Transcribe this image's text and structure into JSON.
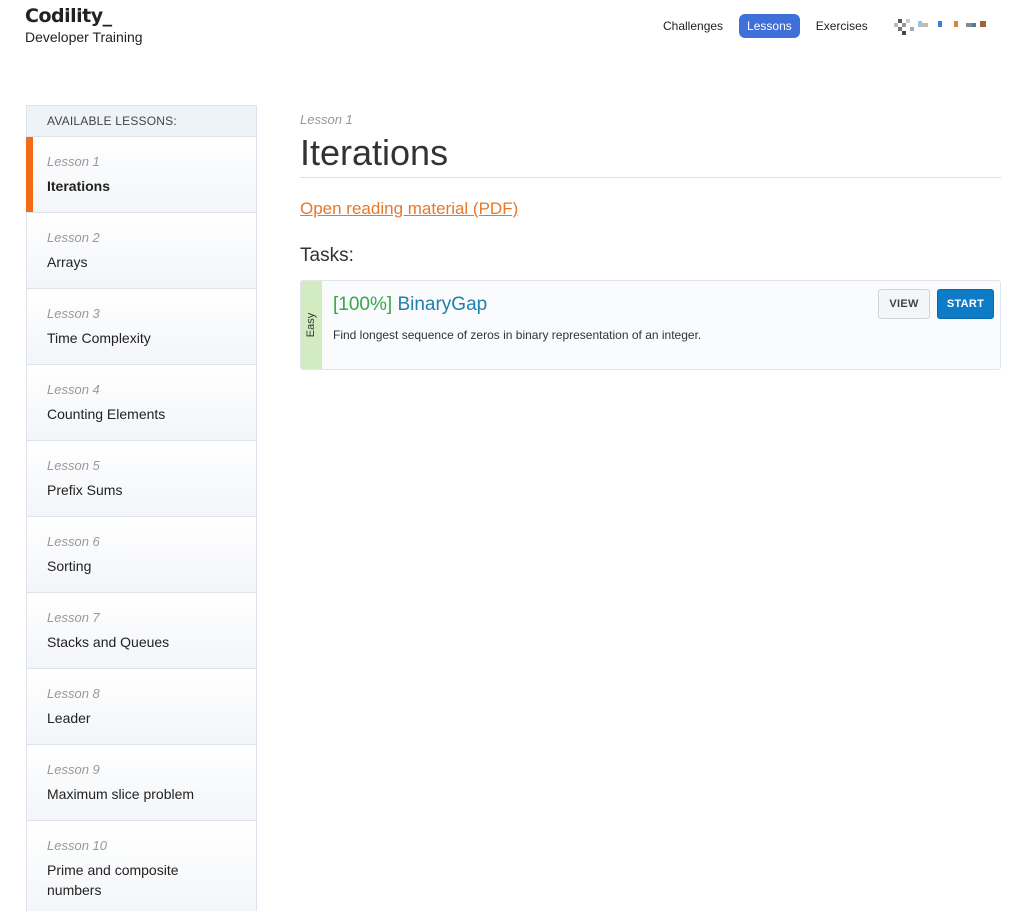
{
  "header": {
    "logo": "Codility_",
    "subtitle": "Developer Training",
    "nav": [
      {
        "label": "Challenges",
        "active": false
      },
      {
        "label": "Lessons",
        "active": true
      },
      {
        "label": "Exercises",
        "active": false
      }
    ],
    "accent_color": "#3f6fd9"
  },
  "sidebar": {
    "header": "AVAILABLE LESSONS:",
    "items": [
      {
        "number": "Lesson 1",
        "name": "Iterations",
        "active": true
      },
      {
        "number": "Lesson 2",
        "name": "Arrays",
        "active": false
      },
      {
        "number": "Lesson 3",
        "name": "Time Complexity",
        "active": false
      },
      {
        "number": "Lesson 4",
        "name": "Counting Elements",
        "active": false
      },
      {
        "number": "Lesson 5",
        "name": "Prefix Sums",
        "active": false
      },
      {
        "number": "Lesson 6",
        "name": "Sorting",
        "active": false
      },
      {
        "number": "Lesson 7",
        "name": "Stacks and Queues",
        "active": false
      },
      {
        "number": "Lesson 8",
        "name": "Leader",
        "active": false
      },
      {
        "number": "Lesson 9",
        "name": "Maximum slice problem",
        "active": false
      },
      {
        "number": "Lesson 10",
        "name": "Prime and composite numbers",
        "active": false
      }
    ],
    "active_marker_color": "#f26b16"
  },
  "main": {
    "lesson_number": "Lesson 1",
    "title": "Iterations",
    "pdf_link": "Open reading material (PDF)",
    "tasks_heading": "Tasks:",
    "tasks": [
      {
        "difficulty": "Easy",
        "score": "[100%]",
        "name": "BinaryGap",
        "description": "Find longest sequence of zeros in binary representation of an integer.",
        "view_label": "VIEW",
        "start_label": "START"
      }
    ]
  }
}
